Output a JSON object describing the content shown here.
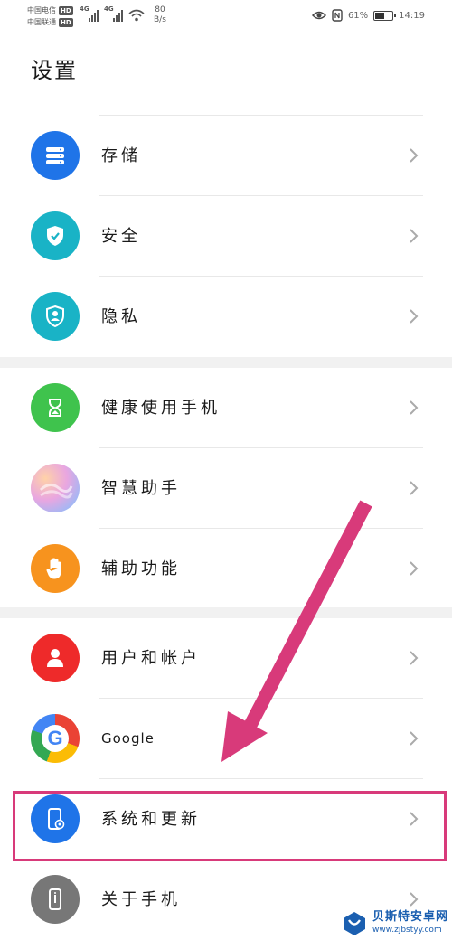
{
  "status_bar": {
    "carrier_1": "中国电信",
    "carrier_2": "中国联通",
    "hd_badge": "HD",
    "network_type": "4G",
    "net_speed_value": "80",
    "net_speed_unit": "B/s",
    "battery_percent": "61%",
    "battery_level": 0.61,
    "time": "14:19"
  },
  "page_title": "设置",
  "groups": [
    {
      "items": [
        {
          "label": "存储",
          "icon": "storage-icon",
          "color": "#1f74e8"
        },
        {
          "label": "安全",
          "icon": "security-shield-icon",
          "color": "#19b3c6"
        },
        {
          "label": "隐私",
          "icon": "privacy-icon",
          "color": "#19b3c6"
        }
      ]
    },
    {
      "items": [
        {
          "label": "健康使用手机",
          "icon": "hourglass-icon",
          "color": "#3fc34d"
        },
        {
          "label": "智慧助手",
          "icon": "smart-assistant-icon",
          "color": "#c9a8f0"
        },
        {
          "label": "辅助功能",
          "icon": "hand-icon",
          "color": "#f7931e"
        }
      ]
    },
    {
      "items": [
        {
          "label": "用户和帐户",
          "icon": "user-icon",
          "color": "#ee2a2a"
        },
        {
          "label": "Google",
          "icon": "google-icon",
          "color": "#4285f4"
        },
        {
          "label": "系统和更新",
          "icon": "system-update-icon",
          "color": "#1f74e8"
        },
        {
          "label": "关于手机",
          "icon": "phone-info-icon",
          "color": "#777777"
        }
      ]
    }
  ],
  "annotation": {
    "highlight_color": "#d83a7a"
  },
  "watermark": {
    "title": "贝斯特安卓网",
    "url": "www.zjbstyy.com"
  }
}
